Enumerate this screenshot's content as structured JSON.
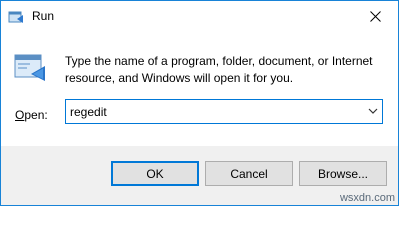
{
  "window": {
    "title": "Run",
    "close_glyph": "✕",
    "title_icon": "run-icon",
    "accent": "#0078d7"
  },
  "body": {
    "description": "Type the name of a program, folder, document, or Internet resource, and Windows will open it for you."
  },
  "open_field": {
    "label_prefix": "O",
    "label_rest": "pen:",
    "value": "regedit"
  },
  "buttons": {
    "ok": "OK",
    "cancel": "Cancel",
    "browse": "Browse..."
  },
  "watermark": "wsxdn.com"
}
